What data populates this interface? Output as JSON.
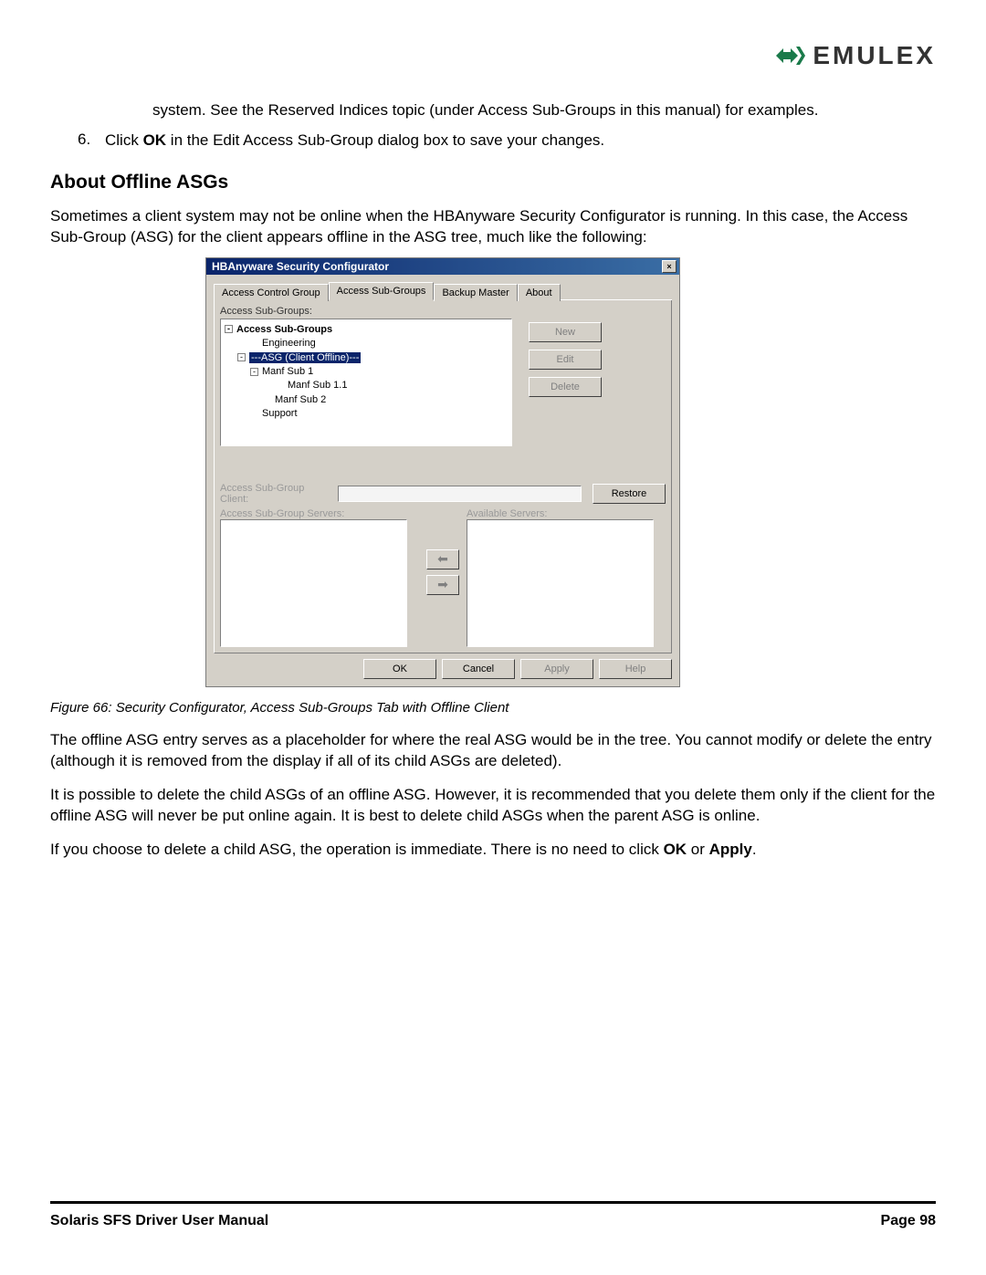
{
  "logo": {
    "text": "EMULEX"
  },
  "para1": "system. See the Reserved Indices topic (under Access Sub-Groups in this manual) for examples.",
  "step6_num": "6.",
  "step6_pre": "Click ",
  "step6_bold": "OK",
  "step6_post": " in the Edit Access Sub-Group dialog box to save your changes.",
  "heading": "About Offline ASGs",
  "para2": "Sometimes a client system may not be online when the HBAnyware Security Configurator is running. In this case, the Access Sub-Group (ASG) for the client appears offline in the ASG tree, much like the following:",
  "dialog": {
    "title": "HBAnyware Security Configurator",
    "close": "×",
    "tabs": [
      "Access Control Group",
      "Access Sub-Groups",
      "Backup Master",
      "About"
    ],
    "tree_label": "Access Sub-Groups:",
    "tree": {
      "root": "Access Sub-Groups",
      "n1": "Engineering",
      "n2": "---ASG (Client Offline)---",
      "n3": "Manf Sub 1",
      "n4": "Manf Sub 1.1",
      "n5": "Manf Sub 2",
      "n6": "Support"
    },
    "buttons": {
      "new": "New",
      "edit": "Edit",
      "delete": "Delete",
      "restore": "Restore"
    },
    "client_label": "Access Sub-Group Client:",
    "servers_label": "Access Sub-Group Servers:",
    "avail_label": "Available Servers:",
    "arrows": {
      "left": "⬅",
      "right": "➡"
    },
    "bottom": {
      "ok": "OK",
      "cancel": "Cancel",
      "apply": "Apply",
      "help": "Help"
    }
  },
  "caption": "Figure 66: Security Configurator, Access Sub-Groups Tab with Offline Client",
  "para3": "The offline ASG entry serves as a placeholder for where the real ASG would be in the tree. You cannot modify or delete the entry (although it is removed from the display if all of its child ASGs are deleted).",
  "para4": "It is possible to delete the child ASGs of an offline ASG. However, it is recommended that you delete them only if the client for the offline ASG will never be put online again. It is best to delete child ASGs when the parent ASG is online.",
  "para5_pre": "If you choose to delete a child ASG, the operation is immediate. There is no need to click ",
  "para5_b1": "OK",
  "para5_mid": " or ",
  "para5_b2": "Apply",
  "para5_post": ".",
  "footer": {
    "left": "Solaris SFS Driver User Manual",
    "right": "Page 98"
  }
}
